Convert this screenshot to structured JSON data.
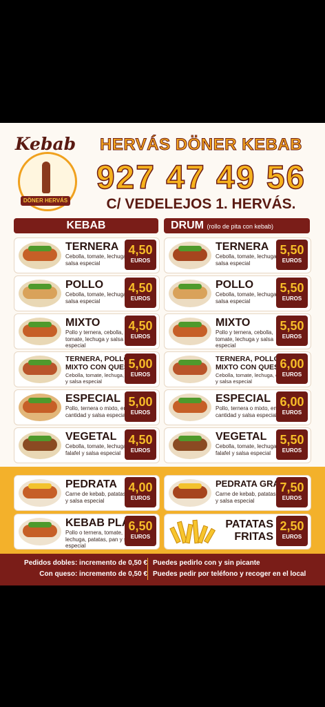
{
  "header": {
    "logo_title": "Kebab",
    "logo_ribbon": "DÖNER HERVÁS",
    "name": "HERVÁS DÖNER KEBAB",
    "phone": "927 47 49 56",
    "address": "C/ VEDELEJOS 1. HERVÁS."
  },
  "columns": {
    "kebab": {
      "title": "KEBAB"
    },
    "drum": {
      "title": "DRUM",
      "subtitle": "(rollo de pita con kebab)"
    }
  },
  "currency": "EUROS",
  "kebab_items": [
    {
      "name": "TERNERA",
      "desc": "Cebolla, tomate, lechuga y salsa especial",
      "price": "4,50"
    },
    {
      "name": "POLLO",
      "desc": "Cebolla, tomate, lechuga y salsa especial",
      "price": "4,50"
    },
    {
      "name": "MIXTO",
      "desc": "Pollo y ternera, cebolla, tomate, lechuga y salsa especial",
      "price": "4,50"
    },
    {
      "name": "TERNERA, POLLO O MIXTO CON QUESO",
      "desc": "Cebolla, tomate, lechuga, queso y salsa especial",
      "price": "5,00"
    },
    {
      "name": "ESPECIAL",
      "desc": "Pollo, ternera o mixto, en más cantidad y salsa especial",
      "price": "5,00"
    },
    {
      "name": "VEGETAL",
      "desc": "Cebolla, tomate, lechuga falafel y salsa especial",
      "price": "4,50"
    }
  ],
  "drum_items": [
    {
      "name": "TERNERA",
      "desc": "Cebolla, tomate, lechuga y salsa especial",
      "price": "5,50"
    },
    {
      "name": "POLLO",
      "desc": "Cebolla, tomate, lechuga y salsa especial",
      "price": "5,50"
    },
    {
      "name": "MIXTO",
      "desc": "Pollo y ternera, cebolla, tomate, lechuga y salsa especial",
      "price": "5,50"
    },
    {
      "name": "TERNERA, POLLO O MIXTO CON QUESO",
      "desc": "Cebolla, tomate, lechuga, queso y salsa especial",
      "price": "6,00"
    },
    {
      "name": "ESPECIAL",
      "desc": "Pollo, ternera o mixto, en más cantidad y salsa especial",
      "price": "6,00"
    },
    {
      "name": "VEGETAL",
      "desc": "Cebolla, tomate, lechuga falafel y salsa especial",
      "price": "5,50"
    }
  ],
  "extras": [
    {
      "name": "PEDRATA",
      "desc": "Carne de kebab, patatas fritas y salsa especial",
      "price": "4,00"
    },
    {
      "name": "PEDRATA GRANDE",
      "desc": "Carne de kebab, patatas fritas y salsa especial",
      "price": "7,50"
    },
    {
      "name": "KEBAB PLATO",
      "desc": "Pollo o ternera, tomate, lechuga, patatas, pan y salsa especial",
      "price": "6,50"
    },
    {
      "name": "PATATAS FRITAS",
      "desc": "",
      "price": "2,50"
    }
  ],
  "footer": {
    "left1": "Pedidos dobles: incremento de 0,50 €",
    "left2": "Con queso: incremento de 0,50 €",
    "right1": "Puedes pedirlo con y sin picante",
    "right2": "Puedes pedir por teléfono y recoger en el local"
  },
  "colors": {
    "maroon": "#7a1d18",
    "gold": "#f3b12b",
    "cream": "#fdf9f3"
  }
}
